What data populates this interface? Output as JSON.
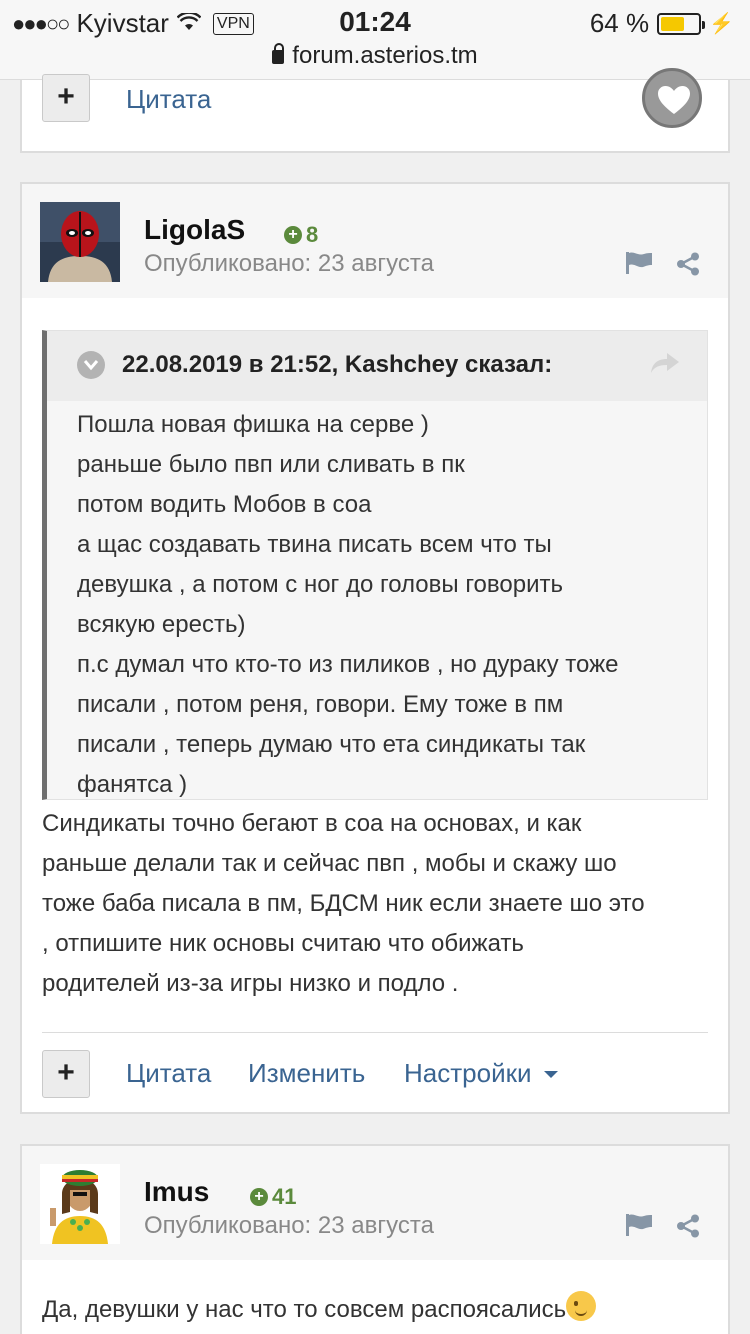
{
  "status_bar": {
    "carrier": "Kyivstar",
    "vpn": "VPN",
    "time": "01:24",
    "battery_percent": "64 %",
    "battery_level": 0.64,
    "url": "forum.asterios.tm"
  },
  "prev_post": {
    "plus": "+",
    "quote_label": "Цитата"
  },
  "post1": {
    "username": "LigolaS",
    "rep": "8",
    "posted": "Опубликовано: 23 августа",
    "quote": {
      "title": "22.08.2019 в 21:52, Kashchey сказал:",
      "lines": [
        "Пошла новая фишка на серве )",
        "раньше было пвп или сливать в пк",
        "потом водить Мобов в соа",
        "а щас создавать твина писать всем что ты",
        "девушка , а потом с ног до головы говорить",
        "всякую ересть)",
        "п.с думал что кто-то из пиликов , но дураку тоже",
        "писали , потом реня, говори. Ему тоже в пм",
        "писали , теперь думаю что ета синдикаты так",
        "фанятса )"
      ]
    },
    "body_lines": [
      "Синдикаты точно бегают в соа на основах, и как",
      "раньше делали так и сейчас пвп , мобы  и скажу шо",
      "тоже баба писала в пм, БДСМ ник если знаете шо это",
      ",  отпишите ник основы считаю что обижать",
      "родителей из-за игры низко и подло ."
    ],
    "actions": {
      "plus": "+",
      "quote": "Цитата",
      "edit": "Изменить",
      "settings": "Настройки"
    }
  },
  "post2": {
    "username": "Imus",
    "rep": "41",
    "posted": "Опубликовано: 23 августа",
    "body_line": "Да, девушки у нас что то совсем распоясались"
  }
}
